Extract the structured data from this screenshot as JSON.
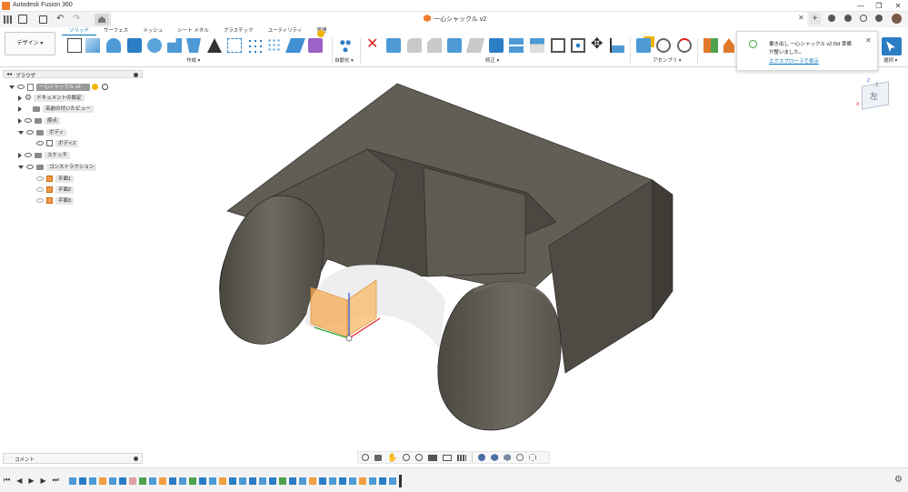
{
  "titlebar": {
    "app_title": "Autodesk Fusion 360",
    "minimize": "—",
    "restore": "❐",
    "close": "✕"
  },
  "document": {
    "title": "一心シャックル v2",
    "close": "✕",
    "add": "+"
  },
  "tabs": [
    "ソリッド",
    "サーフェス",
    "メッシュ",
    "シート メタル",
    "プラスチック",
    "ユーティリティ",
    "管理"
  ],
  "workspace": {
    "label": "デザイン ▾"
  },
  "ribbon_groups": {
    "create": "作成 ▾",
    "automate": "自動化 ▾",
    "modify": "修正 ▾",
    "assemble": "アセンブリ ▾",
    "select": "選択 ▾"
  },
  "browser": {
    "title": "ブラウザ",
    "root": "一心シャックル v2",
    "items": [
      "ドキュメントの設定",
      "名前の付いたビュー",
      "原点",
      "ボディ",
      "ボディ2",
      "スケッチ",
      "コンストラクション",
      "平面1",
      "平面2",
      "平面3"
    ]
  },
  "notification": {
    "line1": "書き出し 一心シャックル v2.f3d 準備",
    "line2": "が整いました。",
    "link": "エクスプローラで表示"
  },
  "viewcube": {
    "face": "左",
    "top": "上",
    "z": "Z",
    "x": "X"
  },
  "comments": {
    "label": "コメント"
  },
  "colors": {
    "accent": "#0073b8",
    "model": "#5f5b52",
    "plane": "#f39a45",
    "notif_ok": "#3d9f3d"
  }
}
